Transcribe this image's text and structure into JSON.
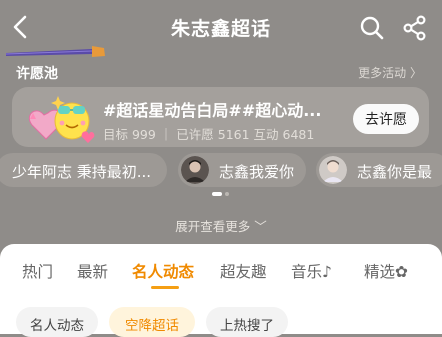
{
  "header": {
    "title": "朱志鑫超话",
    "back_icon": "chevron-left-icon",
    "search_icon": "search-icon",
    "share_icon": "share-icon"
  },
  "wish_pool": {
    "label": "许愿池",
    "more": "更多活动 〉",
    "card": {
      "title": "#超话星动告白局##超心动...",
      "stats": "目标 999 ｜ 已许愿 5161 互动 6481",
      "button": "去许愿"
    },
    "chips": [
      {
        "text": "少年阿志 秉持最初..."
      },
      {
        "text": "志鑫我爱你"
      },
      {
        "text": "志鑫你是最"
      }
    ],
    "carousel_position": 1
  },
  "expand": "展开查看更多 ﹀",
  "tabs": [
    {
      "label": "热门"
    },
    {
      "label": "最新"
    },
    {
      "label": "名人动态",
      "active": true
    },
    {
      "label": "超友趣"
    },
    {
      "label": "音乐♪"
    },
    {
      "label": "精选✿"
    }
  ],
  "pills": [
    {
      "label": "名人动态"
    },
    {
      "label": "空降超话",
      "active": true
    },
    {
      "label": "上热搜了"
    }
  ],
  "colors": {
    "accent": "#f08a00",
    "overlay": "#8f8c89",
    "pill_active_bg": "#fff4dc"
  }
}
